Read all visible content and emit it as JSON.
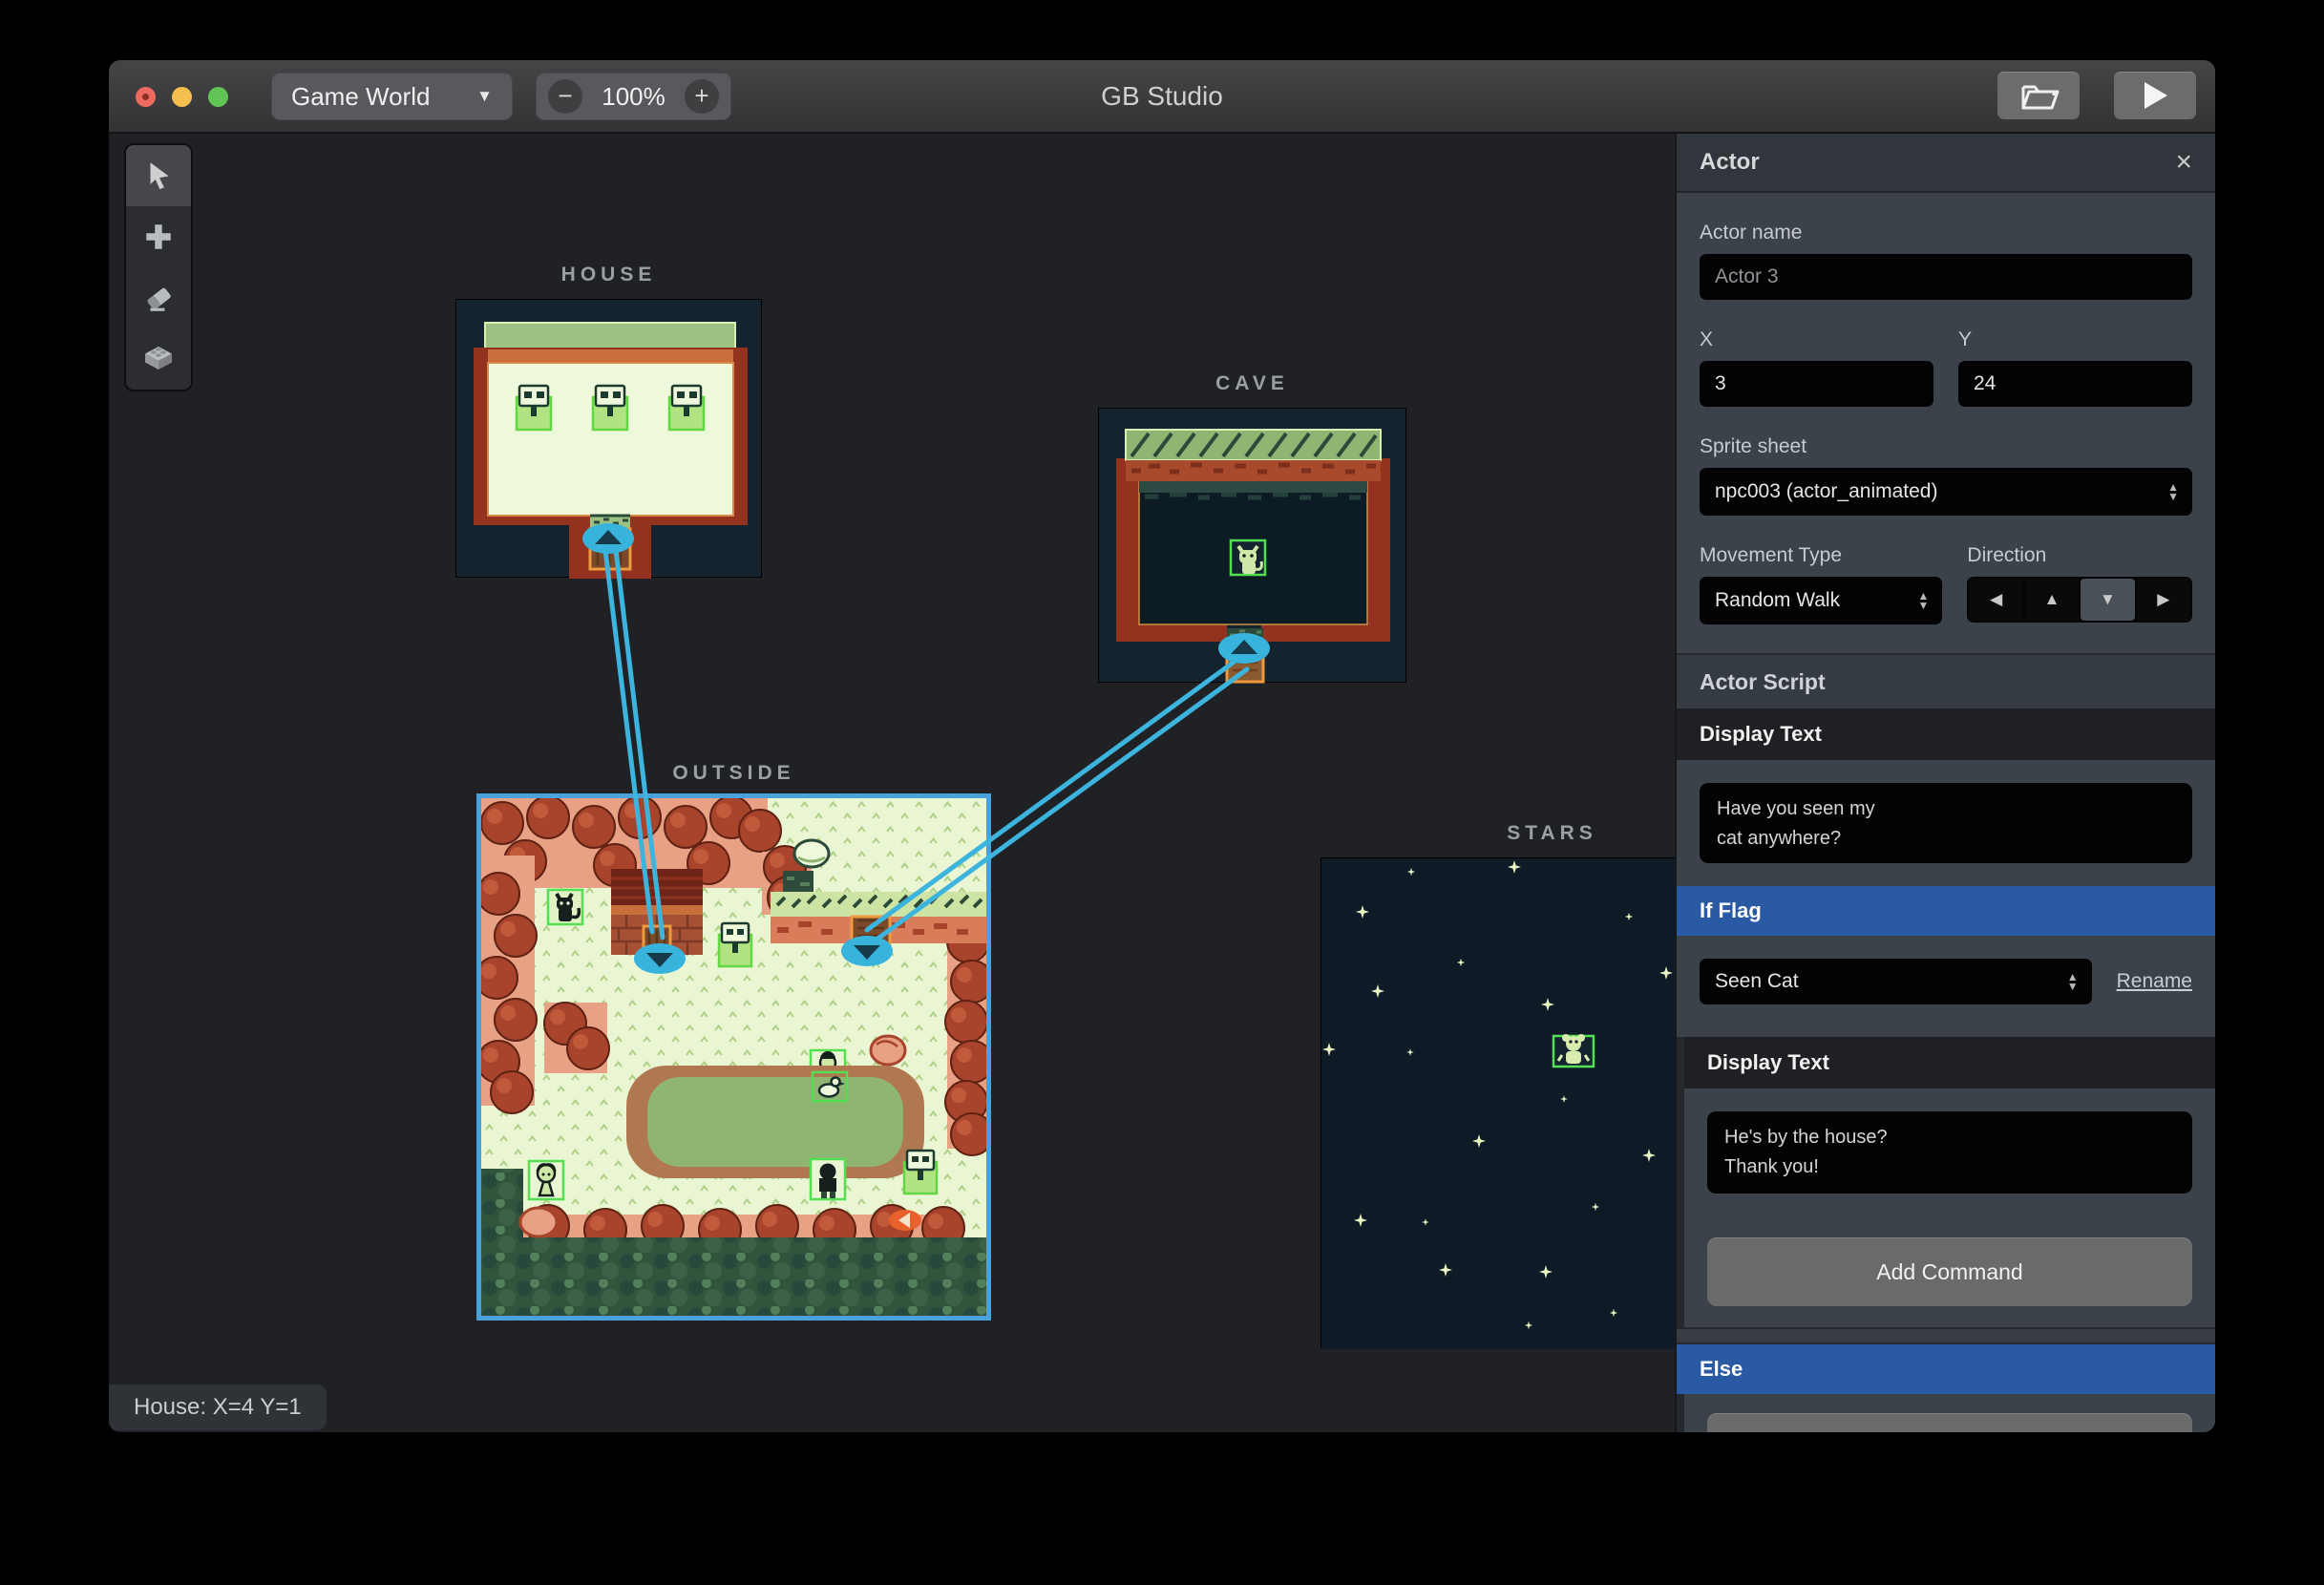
{
  "window": {
    "app_title": "GB Studio"
  },
  "titlebar": {
    "scene_selector_value": "Game World",
    "dropdown_caret": "▼",
    "zoom_out": "−",
    "zoom_level": "100%",
    "zoom_in": "+"
  },
  "tools": [
    "select-tool",
    "add-tool",
    "eraser-tool",
    "collisions-tool"
  ],
  "scenes": {
    "house": "HOUSE",
    "cave": "CAVE",
    "outside": "OUTSIDE",
    "stars": "STARS"
  },
  "statusbar": {
    "hover_info": "House: X=4 Y=1"
  },
  "sidebar": {
    "title": "Actor",
    "close": "×",
    "fields": {
      "actor_name_label": "Actor name",
      "actor_name_value": "Actor 3",
      "x_label": "X",
      "x_value": "3",
      "y_label": "Y",
      "y_value": "24",
      "sprite_sheet_label": "Sprite sheet",
      "sprite_sheet_value": "npc003 (actor_animated)",
      "movement_type_label": "Movement Type",
      "movement_type_value": "Random Walk",
      "direction_label": "Direction"
    },
    "direction_buttons": [
      "◀",
      "▲",
      "▼",
      "▶"
    ],
    "direction_selected": "down",
    "script": {
      "header": "Actor Script",
      "event1_header": "Display Text",
      "event1_text": "Have you seen my\ncat anywhere?",
      "if_flag_header": "If Flag",
      "flag_value": "Seen Cat",
      "rename_label": "Rename",
      "event2_header": "Display Text",
      "event2_text": "He's by the house?\nThank you!",
      "add_command_label": "Add Command",
      "else_header": "Else"
    }
  },
  "colors": {
    "accent_blue": "#2b5aa5",
    "connection_cyan": "#3db4dd",
    "selection_green": "#52e052",
    "scene_selected_border": "#4aa2dc",
    "gb_cream": "#eaf5d3",
    "gb_red_brown": "#9c3a26"
  }
}
